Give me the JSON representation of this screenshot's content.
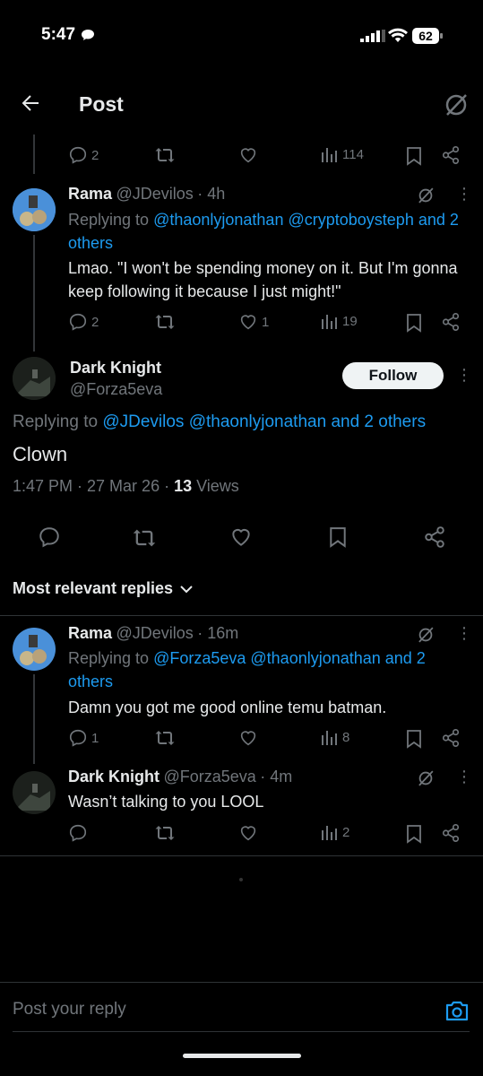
{
  "status_bar": {
    "time": "5:47",
    "battery": "62"
  },
  "header": {
    "title": "Post"
  },
  "top_actions": {
    "reply_count": "2",
    "views": "114"
  },
  "reply1": {
    "name": "Rama",
    "handle": "@JDevilos",
    "time": "· 4h",
    "replying_prefix": "Replying to",
    "mention1": "@thaonlyjonathan",
    "mention2": "@cryptoboysteph",
    "others": "and 2 others",
    "text": "Lmao. \"I won't be spending money on it. But I'm gonna keep following it because I just might!\"",
    "reply_count": "2",
    "like_count": "1",
    "views": "19"
  },
  "main": {
    "name": "Dark Knight",
    "handle": "@Forza5eva",
    "follow_label": "Follow",
    "replying_prefix": "Replying to",
    "mentions": "@JDevilos @thaonlyjonathan and 2 others",
    "text": "Clown",
    "meta_time": "1:47 PM · 27 Mar 26 · ",
    "meta_views_count": "13",
    "meta_views_label": " Views"
  },
  "sort": {
    "label": "Most relevant replies"
  },
  "reply2": {
    "name": "Rama",
    "handle": "@JDevilos",
    "time": "· 16m",
    "replying_prefix": "Replying to",
    "mentions_line1": "@Forza5eva @thaonlyjonathan and 2",
    "mentions_line2": "others",
    "text": "Damn you got me good online temu batman.",
    "reply_count": "1",
    "views": "8"
  },
  "reply3": {
    "name": "Dark Knight",
    "handle": "@Forza5eva",
    "time": "· 4m",
    "text": "Wasn’t talking to you LOOL",
    "views": "2"
  },
  "composer": {
    "placeholder": "Post your reply"
  },
  "colors": {
    "accent": "#1d9bf0",
    "background": "#000000",
    "muted": "#71767b",
    "divider": "#2f3336"
  }
}
